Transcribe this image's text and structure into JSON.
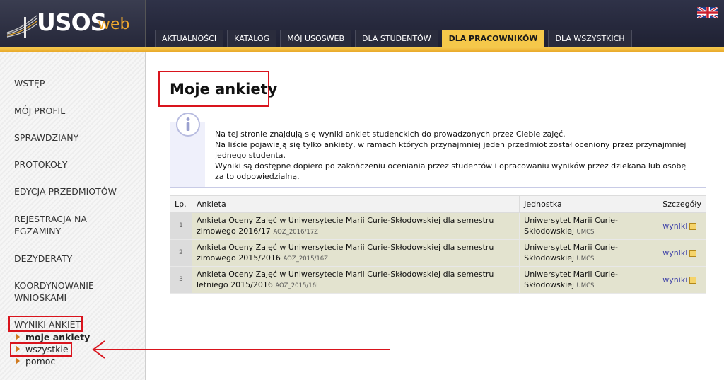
{
  "header": {
    "logo_main": "USOS",
    "logo_suffix": "web",
    "nav_tabs": [
      {
        "label": "AKTUALNOŚCI"
      },
      {
        "label": "KATALOG"
      },
      {
        "label": "MÓJ USOSWEB"
      },
      {
        "label": "DLA STUDENTÓW"
      },
      {
        "label": "DLA PRACOWNIKÓW",
        "active": true
      },
      {
        "label": "DLA WSZYSTKICH"
      }
    ]
  },
  "sidebar": {
    "items": [
      {
        "label": "WSTĘP"
      },
      {
        "label": "MÓJ PROFIL"
      },
      {
        "label": "SPRAWDZIANY"
      },
      {
        "label": "PROTOKOŁY"
      },
      {
        "label": "EDYCJA PRZEDMIOTÓW"
      },
      {
        "label": "REJESTRACJA NA EGZAMINY"
      },
      {
        "label": "DEZYDERATY"
      },
      {
        "label": "KOORDYNOWANIE WNIOSKAMI"
      },
      {
        "label": "WYNIKI ANKIET"
      }
    ],
    "subitems": [
      {
        "label": "moje ankiety",
        "current": true
      },
      {
        "label": "wszystkie"
      },
      {
        "label": "pomoc"
      }
    ]
  },
  "main": {
    "title": "Moje ankiety",
    "info": [
      "Na tej stronie znajdują się wyniki ankiet studenckich do prowadzonych przez Ciebie zajęć.",
      "Na liście pojawiają się tylko ankiety, w ramach których przynajmniej jeden przedmiot został oceniony przez przynajmniej jednego studenta.",
      "Wyniki są dostępne dopiero po zakończeniu oceniania przez studentów i opracowaniu wyników przez dziekana lub osobę za to odpowiedzialną."
    ],
    "table": {
      "headers": {
        "lp": "Lp.",
        "survey": "Ankieta",
        "unit": "Jednostka",
        "details": "Szczegóły"
      },
      "rows": [
        {
          "lp": "1",
          "survey": "Ankieta Oceny Zajęć w Uniwersytecie Marii Curie-Skłodowskiej dla semestru zimowego 2016/17",
          "code": "AOZ_2016/17Z",
          "unit": "Uniwersytet Marii Curie-Skłodowskiej",
          "unit_code": "UMCS",
          "link": "wyniki"
        },
        {
          "lp": "2",
          "survey": "Ankieta Oceny Zajęć w Uniwersytecie Marii Curie-Skłodowskiej dla semestru zimowego 2015/2016",
          "code": "AOZ_2015/16Z",
          "unit": "Uniwersytet Marii Curie-Skłodowskiej",
          "unit_code": "UMCS",
          "link": "wyniki"
        },
        {
          "lp": "3",
          "survey": "Ankieta Oceny Zajęć w Uniwersytecie Marii Curie-Skłodowskiej dla semestru letniego 2015/2016",
          "code": "AOZ_2015/16L",
          "unit": "Uniwersytet Marii Curie-Skłodowskiej",
          "unit_code": "UMCS",
          "link": "wyniki"
        }
      ]
    }
  },
  "colors": {
    "accent": "#f5c84a",
    "highlight": "#d9141d",
    "link": "#3f42a8"
  }
}
